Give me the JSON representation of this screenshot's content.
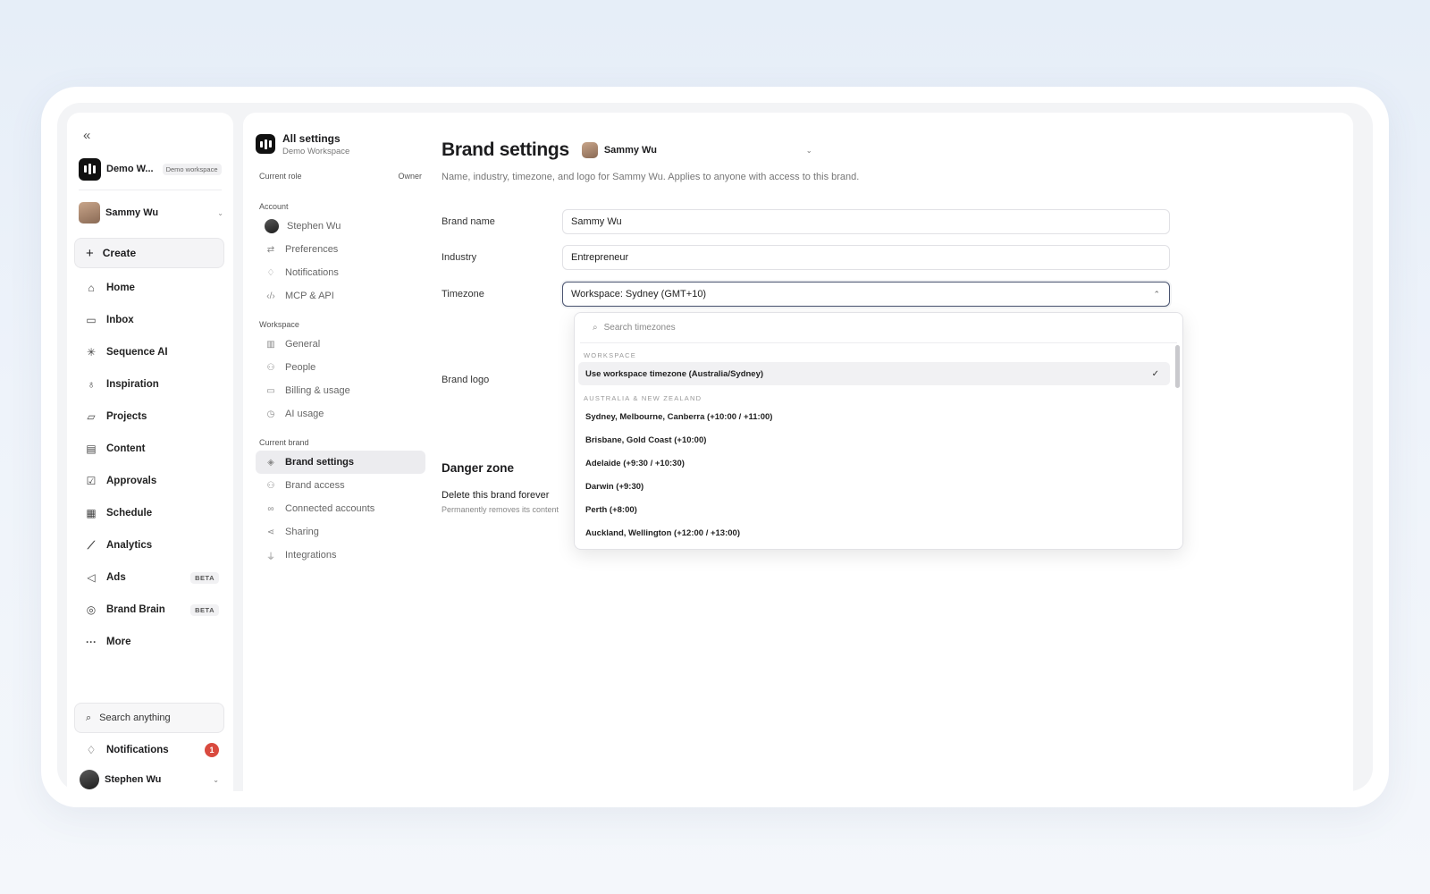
{
  "sidebar": {
    "workspace_name": "Demo W...",
    "workspace_badge": "Demo workspace",
    "brand_user": "Sammy Wu",
    "create_label": "Create",
    "nav": [
      {
        "label": "Home",
        "icon": "home-icon",
        "glyph": "⌂",
        "badge": ""
      },
      {
        "label": "Inbox",
        "icon": "inbox-icon",
        "glyph": "▭",
        "badge": ""
      },
      {
        "label": "Sequence AI",
        "icon": "sparkle-icon",
        "glyph": "✳",
        "badge": ""
      },
      {
        "label": "Inspiration",
        "icon": "lightbulb-icon",
        "glyph": "♁",
        "badge": ""
      },
      {
        "label": "Projects",
        "icon": "folder-icon",
        "glyph": "▱",
        "badge": ""
      },
      {
        "label": "Content",
        "icon": "document-icon",
        "glyph": "▤",
        "badge": ""
      },
      {
        "label": "Approvals",
        "icon": "checkbox-icon",
        "glyph": "☑",
        "badge": ""
      },
      {
        "label": "Schedule",
        "icon": "calendar-icon",
        "glyph": "▦",
        "badge": ""
      },
      {
        "label": "Analytics",
        "icon": "chart-line-icon",
        "glyph": "⟋",
        "badge": ""
      },
      {
        "label": "Ads",
        "icon": "megaphone-icon",
        "glyph": "◁",
        "badge": "BETA"
      },
      {
        "label": "Brand Brain",
        "icon": "brain-icon",
        "glyph": "◎",
        "badge": "BETA"
      },
      {
        "label": "More",
        "icon": "more-icon",
        "glyph": "···",
        "badge": ""
      }
    ],
    "search_placeholder": "Search anything",
    "notifications_label": "Notifications",
    "notifications_count": "1",
    "current_user": "Stephen Wu"
  },
  "settings_nav": {
    "title": "All settings",
    "subtitle": "Demo Workspace",
    "role_label": "Current role",
    "role_value": "Owner",
    "account_label": "Account",
    "account_items": [
      {
        "label": "Stephen Wu",
        "icon": "avatar"
      },
      {
        "label": "Preferences",
        "icon": "sliders-icon",
        "glyph": "⇄"
      },
      {
        "label": "Notifications",
        "icon": "bell-icon",
        "glyph": "♢"
      },
      {
        "label": "MCP & API",
        "icon": "code-icon",
        "glyph": "‹/›"
      }
    ],
    "workspace_label": "Workspace",
    "workspace_items": [
      {
        "label": "General",
        "icon": "building-icon",
        "glyph": "▥"
      },
      {
        "label": "People",
        "icon": "people-icon",
        "glyph": "⚇"
      },
      {
        "label": "Billing & usage",
        "icon": "card-icon",
        "glyph": "▭"
      },
      {
        "label": "AI usage",
        "icon": "clock-icon",
        "glyph": "◷"
      }
    ],
    "brand_label": "Current brand",
    "brand_items": [
      {
        "label": "Brand settings",
        "icon": "layers-icon",
        "glyph": "◈",
        "active": true
      },
      {
        "label": "Brand access",
        "icon": "people-icon",
        "glyph": "⚇",
        "active": false
      },
      {
        "label": "Connected accounts",
        "icon": "link-icon",
        "glyph": "∞",
        "active": false
      },
      {
        "label": "Sharing",
        "icon": "share-icon",
        "glyph": "⋖",
        "active": false
      },
      {
        "label": "Integrations",
        "icon": "plug-icon",
        "glyph": "⏚",
        "active": false
      }
    ]
  },
  "content": {
    "title": "Brand settings",
    "brand_picker": "Sammy Wu",
    "description": "Name, industry, timezone, and logo for Sammy Wu. Applies to anyone with access to this brand.",
    "brand_name_label": "Brand name",
    "brand_name_value": "Sammy Wu",
    "industry_label": "Industry",
    "industry_value": "Entrepreneur",
    "timezone_label": "Timezone",
    "timezone_value": "Workspace: Sydney (GMT+10)",
    "logo_label": "Brand logo",
    "danger_title": "Danger zone",
    "danger_label": "Delete this brand forever",
    "danger_desc": "Permanently removes its content"
  },
  "dropdown": {
    "search_placeholder": "Search timezones",
    "group_workspace": "WORKSPACE",
    "workspace_option": "Use workspace timezone (Australia/Sydney)",
    "group_anz": "AUSTRALIA & NEW ZEALAND",
    "options": [
      "Sydney, Melbourne, Canberra (+10:00 / +11:00)",
      "Brisbane, Gold Coast (+10:00)",
      "Adelaide (+9:30 / +10:30)",
      "Darwin (+9:30)",
      "Perth (+8:00)",
      "Auckland, Wellington (+12:00 / +13:00)"
    ]
  }
}
